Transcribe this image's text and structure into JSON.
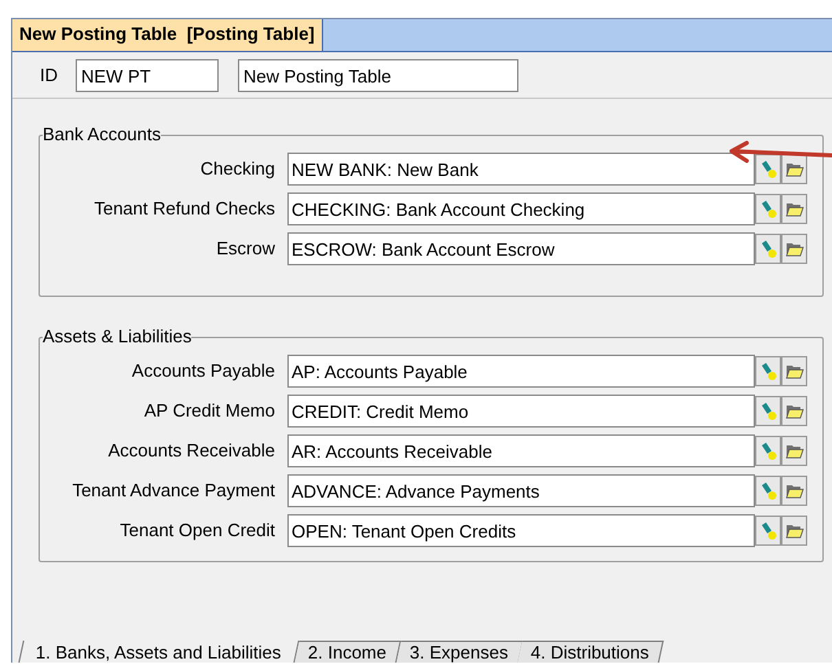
{
  "window": {
    "title": "New Posting Table  [Posting Table]"
  },
  "id_label": "ID",
  "id_value": "NEW PT",
  "description": "New Posting Table",
  "groups": [
    {
      "title": "Bank Accounts",
      "rows": [
        {
          "label": "Checking",
          "value": "NEW BANK: New Bank"
        },
        {
          "label": "Tenant Refund Checks",
          "value": "CHECKING: Bank Account Checking"
        },
        {
          "label": "Escrow",
          "value": "ESCROW: Bank Account Escrow"
        }
      ]
    },
    {
      "title": "Assets & Liabilities",
      "rows": [
        {
          "label": "Accounts Payable",
          "value": "AP: Accounts Payable"
        },
        {
          "label": "AP Credit Memo",
          "value": "CREDIT: Credit Memo"
        },
        {
          "label": "Accounts Receivable",
          "value": "AR: Accounts Receivable"
        },
        {
          "label": "Tenant Advance Payment",
          "value": "ADVANCE: Advance Payments"
        },
        {
          "label": "Tenant Open Credit",
          "value": "OPEN: Tenant Open Credits"
        }
      ]
    }
  ],
  "tabs": [
    {
      "label": "1. Banks, Assets and Liabilities",
      "selected": true
    },
    {
      "label": "2. Income",
      "selected": false
    },
    {
      "label": "3. Expenses",
      "selected": false
    },
    {
      "label": "4. Distributions",
      "selected": false
    }
  ]
}
